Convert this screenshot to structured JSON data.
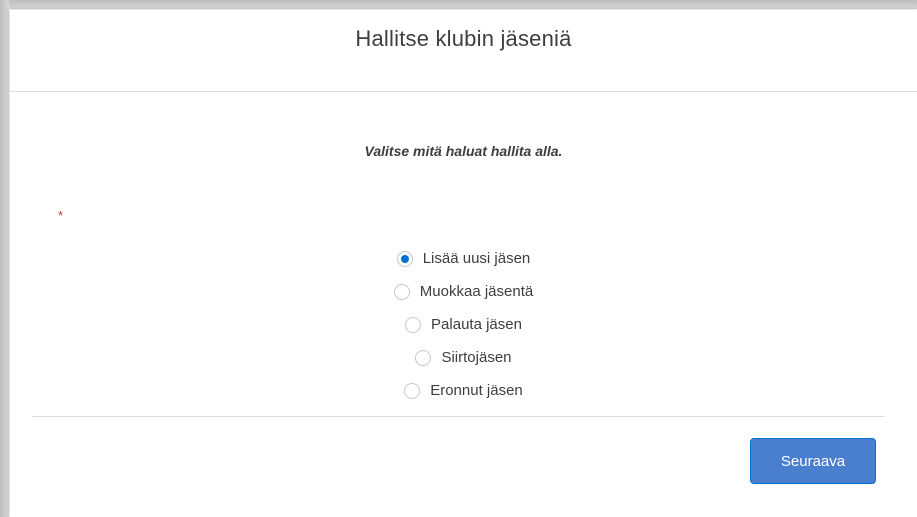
{
  "colors": {
    "accent": "#0070d2",
    "button_bg": "#4a7fd0",
    "required": "#c23934"
  },
  "modal": {
    "title": "Hallitse klubin jäseniä",
    "instruction": "Valitse mitä haluat hallita alla.",
    "required_marker": "*",
    "options": [
      {
        "label": "Lisää uusi jäsen",
        "checked": true
      },
      {
        "label": "Muokkaa jäsentä",
        "checked": false
      },
      {
        "label": "Palauta jäsen",
        "checked": false
      },
      {
        "label": "Siirtojäsen",
        "checked": false
      },
      {
        "label": "Eronnut jäsen",
        "checked": false
      }
    ],
    "next_label": "Seuraava"
  }
}
